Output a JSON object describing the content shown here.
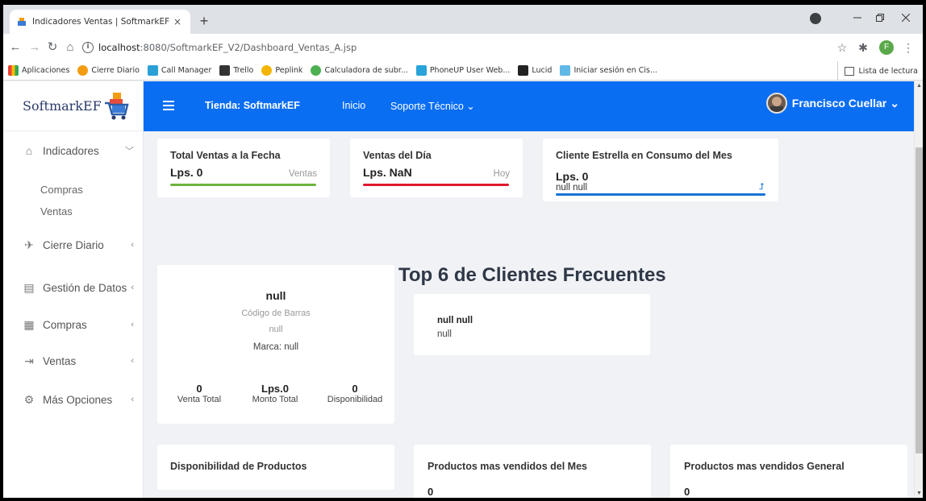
{
  "browser": {
    "tab_title": "Indicadores Ventas | SoftmarkEF",
    "tab_close": "×",
    "new_tab": "+",
    "url_host": "localhost",
    "url_path": ":8080/SoftmarkEF_V2/Dashboard_Ventas_A.jsp",
    "profile_initial": "F",
    "bookmarks": [
      "Aplicaciones",
      "Cierre Diario",
      "Call Manager",
      "Trello",
      "Peplink",
      "Calculadora de subr...",
      "PhoneUP User Web...",
      "Lucid",
      "Iniciar sesión en Cis..."
    ],
    "reading_list": "Lista de lectura"
  },
  "app": {
    "brand": "SoftmarkEF",
    "nav": {
      "store": "Tienda: SoftmarkEF",
      "home": "Inicio",
      "support": "Soporte Técnico",
      "user": "Francisco Cuellar"
    },
    "sidebar": {
      "items": [
        {
          "label": "Indicadores",
          "icon": "home-icon"
        },
        {
          "label": "Cierre Diario",
          "icon": "rocket-icon"
        },
        {
          "label": "Gestión de Datos",
          "icon": "document-icon"
        },
        {
          "label": "Compras",
          "icon": "building-icon"
        },
        {
          "label": "Ventas",
          "icon": "exit-icon"
        },
        {
          "label": "Más Opciones",
          "icon": "gear-icon"
        }
      ],
      "sub": [
        "Compras",
        "Ventas"
      ]
    },
    "cards": {
      "total_ventas": {
        "title": "Total Ventas a la Fecha",
        "value": "Lps. 0",
        "tag": "Ventas"
      },
      "ventas_dia": {
        "title": "Ventas del Día",
        "value": "Lps. NaN",
        "tag": "Hoy"
      },
      "cliente_estrella": {
        "title": "Cliente Estrella en Consumo del Mes",
        "value": "Lps. 0",
        "name": "null null",
        "arrow": "⮥"
      }
    },
    "product": {
      "name": "null",
      "barcode_label": "Código de Barras",
      "barcode": "null",
      "brand": "Marca: null",
      "stats": [
        {
          "value": "0",
          "label": "Venta Total"
        },
        {
          "value": "Lps.0",
          "label": "Monto Total"
        },
        {
          "value": "0",
          "label": "Disponibilidad"
        }
      ]
    },
    "top6": {
      "title": "Top 6 de Clientes Frecuentes",
      "client_name": "null null",
      "client_sub": "null"
    },
    "bottom": {
      "disponibilidad": "Disponibilidad de Productos",
      "vendidos_mes": "Productos mas vendidos del Mes",
      "vendidos_mes_value": "0",
      "vendidos_general": "Productos mas vendidos General",
      "vendidos_general_value": "0"
    },
    "colors": {
      "primary": "#0a6ef3",
      "green": "#6cb33f",
      "red": "#e0192d",
      "blue": "#1673d6"
    }
  }
}
